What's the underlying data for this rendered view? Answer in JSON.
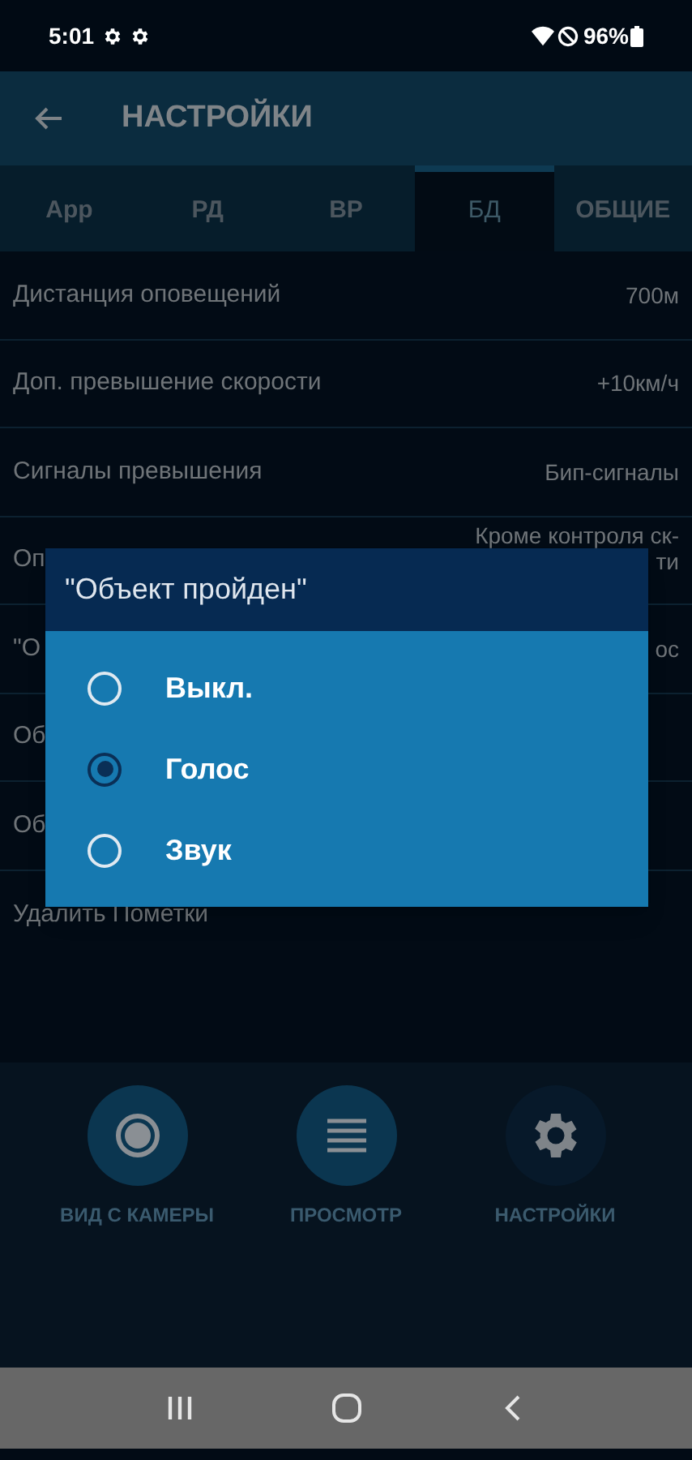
{
  "status_bar": {
    "time": "5:01",
    "battery": "96%"
  },
  "header": {
    "title": "НАСТРОЙКИ"
  },
  "tabs": [
    {
      "label": "App",
      "selected": false
    },
    {
      "label": "РД",
      "selected": false
    },
    {
      "label": "ВР",
      "selected": false
    },
    {
      "label": "БД",
      "selected": true
    },
    {
      "label": "ОБЩИЕ",
      "selected": false
    }
  ],
  "rows": [
    {
      "label": "Дистанция оповещений",
      "value_lines": [
        "700м"
      ]
    },
    {
      "label": "Доп. превышение скорости",
      "value_lines": [
        "+10км/ч"
      ]
    },
    {
      "label": "Сигналы превышения",
      "value_lines": [
        "Бип-сигналы"
      ]
    },
    {
      "label": "Оп",
      "value_lines": [
        "Кроме контроля ск-",
        "ти"
      ]
    },
    {
      "label": "\"О",
      "value_lines": [
        "ос"
      ]
    },
    {
      "label": "Об",
      "value_lines": []
    },
    {
      "label": "Об",
      "value_lines": []
    }
  ],
  "delete_item": {
    "label": "Удалить Пометки"
  },
  "dialog": {
    "title": "\"Объект пройден\"",
    "options": [
      {
        "label": "Выкл.",
        "selected": false
      },
      {
        "label": "Голос",
        "selected": true
      },
      {
        "label": "Звук",
        "selected": false
      }
    ]
  },
  "bottom_nav": [
    {
      "kind": "camera",
      "label": "ВИД С КАМЕРЫ",
      "selected": false
    },
    {
      "kind": "list",
      "label": "ПРОСМОТР",
      "selected": false
    },
    {
      "kind": "settings",
      "label": "НАСТРОЙКИ",
      "selected": true
    }
  ]
}
